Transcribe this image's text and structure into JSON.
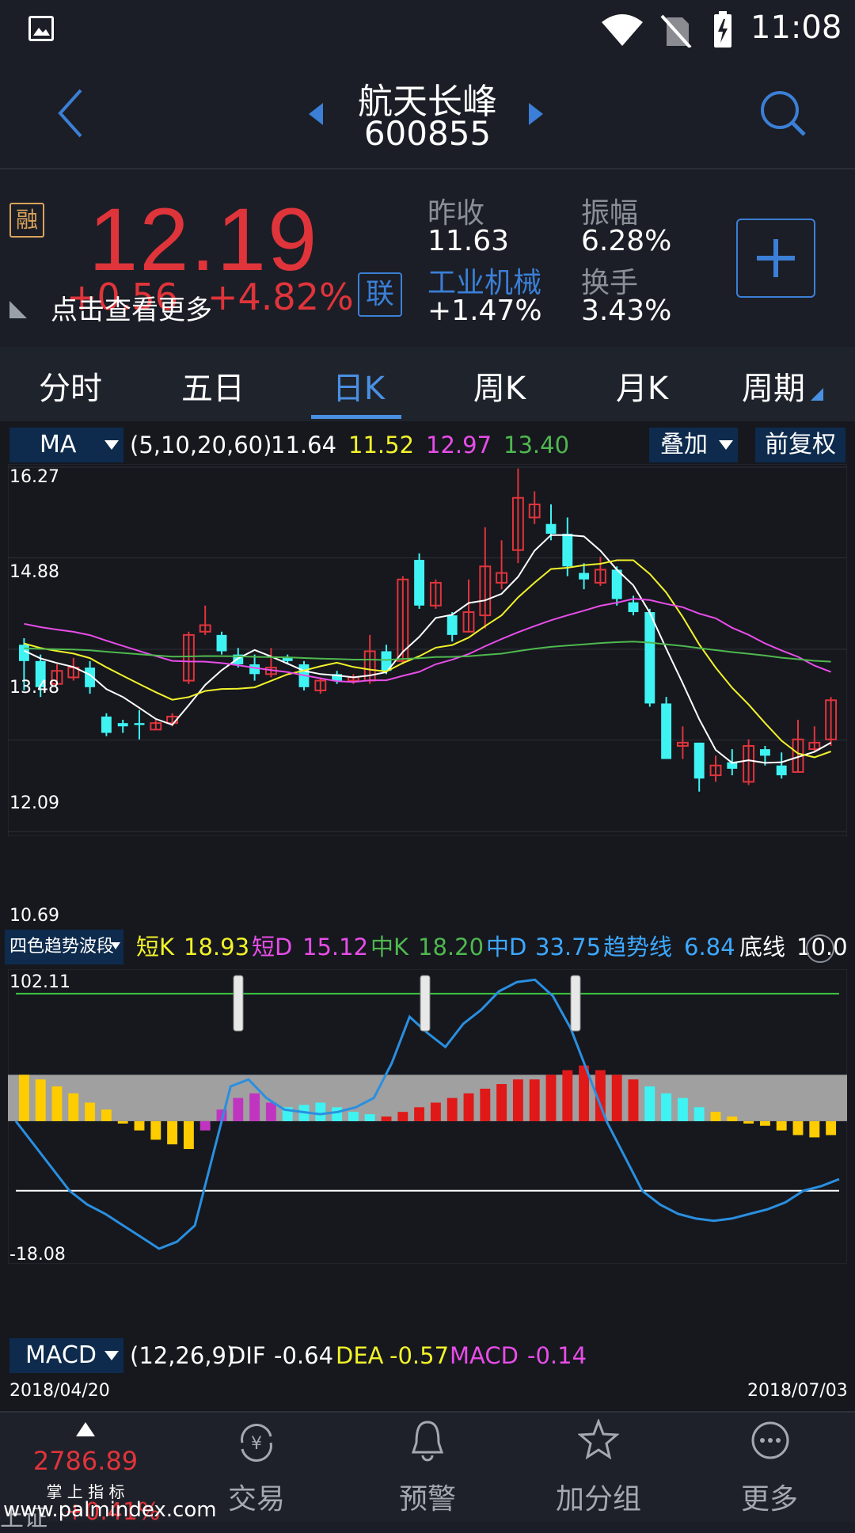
{
  "status_bar": {
    "time": "11:08"
  },
  "header": {
    "stock_name": "航天长峰",
    "stock_code": "600855"
  },
  "quote": {
    "margin_badge": "融",
    "price": "12.19",
    "change": "+0.56",
    "change_pct": "+4.82%",
    "more_hint": "点击查看更多",
    "link_badge": "联",
    "prev_close_label": "昨收",
    "prev_close": "11.63",
    "amplitude_label": "振幅",
    "amplitude": "6.28%",
    "sector_name": "工业机械",
    "sector_change": "+1.47%",
    "turnover_label": "换手",
    "turnover": "3.43%",
    "add_button": "+"
  },
  "tabs": [
    "分时",
    "五日",
    "日K",
    "周K",
    "月K",
    "周期"
  ],
  "active_tab": 2,
  "ma_bar": {
    "selector": "MA",
    "params": "(5,10,20,60)",
    "ma5": "11.64",
    "ma10": "11.52",
    "ma20": "12.97",
    "ma60": "13.40",
    "overlay": "叠加",
    "adjust": "前复权"
  },
  "price_axis": [
    "16.27",
    "14.88",
    "13.48",
    "12.09",
    "10.69"
  ],
  "indicator_bar": {
    "selector": "四色趋势波段",
    "short_k_label": "短K",
    "short_k": "18.93",
    "short_d_label": "短D",
    "short_d": "15.12",
    "mid_k_label": "中K",
    "mid_k": "18.20",
    "mid_d_label": "中D",
    "mid_d": "33.75",
    "trend_label": "趋势线",
    "trend": "6.84",
    "base_label": "底线",
    "base": "10.0"
  },
  "indicator_axis": [
    "102.11",
    "-18.08"
  ],
  "macd_bar": {
    "selector": "MACD",
    "params": "(12,26,9)",
    "dif_label": "DIF",
    "dif": "-0.64",
    "dea_label": "DEA",
    "dea": "-0.57",
    "macd_label": "MACD",
    "macd": "-0.14"
  },
  "date_range": {
    "start": "2018/04/20",
    "end": "2018/07/03"
  },
  "bottom_nav": {
    "index_value": "2786.89",
    "index_change": "+0.41%",
    "index_label": "上证",
    "watermark": "www.palmindex.com",
    "watermark_cn": "掌 上 指 标",
    "items": [
      "交易",
      "预警",
      "加分组",
      "更多"
    ]
  },
  "colors": {
    "up": "#e0343b",
    "down": "#3ff3f3",
    "ma5": "#ffffff",
    "ma10": "#f2f22a",
    "ma20": "#e84de8",
    "ma60": "#4fb84f",
    "accent": "#4a90e2"
  },
  "chart_data": {
    "type": "candlestick",
    "ylim": [
      10.69,
      16.27
    ],
    "ticks": [
      16.27,
      14.88,
      13.48,
      12.09,
      10.69
    ],
    "candles": [
      [
        13.55,
        13.3,
        13.65,
        12.85
      ],
      [
        13.3,
        12.9,
        13.4,
        12.75
      ],
      [
        12.95,
        13.15,
        13.25,
        12.95
      ],
      [
        13.05,
        13.2,
        13.35,
        13.0
      ],
      [
        13.2,
        12.9,
        13.3,
        12.8
      ],
      [
        12.45,
        12.2,
        12.5,
        12.15
      ],
      [
        12.35,
        12.3,
        12.4,
        12.2
      ],
      [
        12.35,
        12.32,
        12.55,
        12.1
      ],
      [
        12.25,
        12.35,
        12.4,
        12.25
      ],
      [
        12.35,
        12.45,
        12.5,
        12.3
      ],
      [
        13.0,
        13.7,
        13.75,
        12.95
      ],
      [
        13.75,
        13.85,
        14.15,
        13.7
      ],
      [
        13.7,
        13.45,
        13.75,
        13.4
      ],
      [
        13.4,
        13.25,
        13.5,
        13.2
      ],
      [
        13.25,
        13.1,
        13.4,
        13.0
      ],
      [
        13.1,
        13.2,
        13.5,
        13.05
      ],
      [
        13.35,
        13.3,
        13.4,
        13.25
      ],
      [
        13.25,
        12.9,
        13.3,
        12.85
      ],
      [
        12.85,
        13.0,
        13.05,
        12.8
      ],
      [
        13.1,
        13.0,
        13.15,
        12.95
      ],
      [
        13.0,
        13.05,
        13.1,
        12.95
      ],
      [
        13.0,
        13.45,
        13.7,
        12.95
      ],
      [
        13.45,
        13.15,
        13.55,
        13.1
      ],
      [
        13.3,
        14.55,
        14.6,
        13.25
      ],
      [
        14.85,
        14.15,
        14.95,
        14.1
      ],
      [
        14.15,
        14.5,
        14.55,
        14.1
      ],
      [
        14.0,
        13.7,
        14.05,
        13.6
      ],
      [
        13.75,
        14.05,
        14.55,
        13.75
      ],
      [
        14.0,
        14.75,
        15.35,
        13.8
      ],
      [
        14.5,
        14.65,
        15.15,
        14.4
      ],
      [
        15.0,
        15.8,
        16.25,
        14.8
      ],
      [
        15.5,
        15.7,
        15.9,
        15.4
      ],
      [
        15.4,
        15.25,
        15.7,
        15.15
      ],
      [
        15.25,
        14.75,
        15.5,
        14.6
      ],
      [
        14.65,
        14.55,
        14.8,
        14.4
      ],
      [
        14.5,
        14.7,
        14.9,
        14.45
      ],
      [
        14.7,
        14.25,
        14.75,
        14.15
      ],
      [
        14.2,
        14.05,
        14.3,
        14.0
      ],
      [
        14.05,
        12.65,
        14.1,
        12.6
      ],
      [
        12.65,
        11.8,
        12.75,
        11.8
      ],
      [
        12.0,
        12.05,
        12.3,
        11.8
      ],
      [
        12.05,
        11.5,
        12.05,
        11.3
      ],
      [
        11.55,
        11.7,
        11.85,
        11.45
      ],
      [
        11.75,
        11.65,
        11.95,
        11.55
      ],
      [
        11.45,
        12.0,
        12.1,
        11.4
      ],
      [
        11.95,
        11.85,
        12.0,
        11.7
      ],
      [
        11.7,
        11.55,
        11.9,
        11.5
      ],
      [
        11.6,
        12.1,
        12.4,
        11.6
      ],
      [
        11.95,
        12.05,
        12.3,
        11.9
      ],
      [
        12.1,
        12.7,
        12.75,
        12.0
      ]
    ]
  }
}
